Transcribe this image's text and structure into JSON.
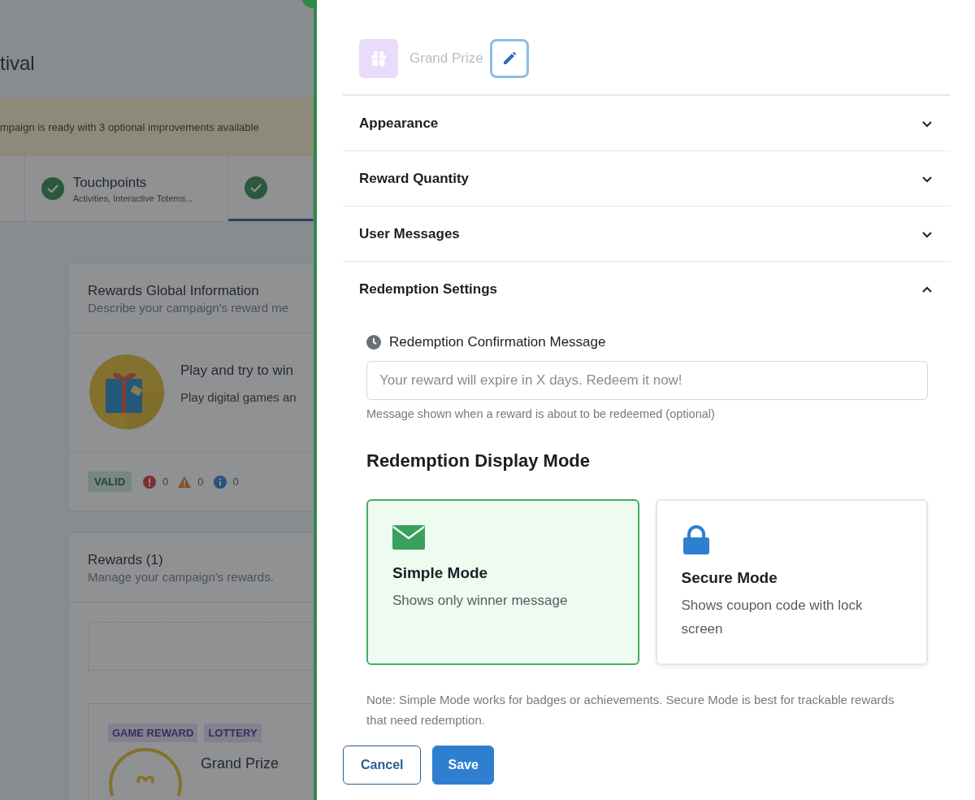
{
  "background_page": {
    "title": "tival",
    "banner": "mpaign is ready with 3 optional improvements available",
    "steps": [
      {
        "title": "Touchpoints",
        "subtitle": "Activities, Interactive Totems...",
        "done": true,
        "selected": false
      },
      {
        "done": true,
        "selected": true
      }
    ],
    "global_info_card": {
      "title": "Rewards Global Information",
      "subtitle": "Describe your campaign's reward me",
      "headline": "Play and try to win",
      "description": "Play digital games an",
      "status": "VALID",
      "counts": [
        {
          "kind": "error",
          "value": "0"
        },
        {
          "kind": "warning",
          "value": "0"
        },
        {
          "kind": "info",
          "value": "0"
        }
      ]
    },
    "rewards_card": {
      "title": "Rewards (1)",
      "subtitle": "Manage your campaign's rewards.",
      "tags": [
        "GAME REWARD",
        "LOTTERY"
      ],
      "reward_name": "Grand Prize"
    }
  },
  "drawer": {
    "reward_name": "Grand Prize",
    "sections": [
      {
        "title": "Appearance",
        "expanded": false
      },
      {
        "title": "Reward Quantity",
        "expanded": false
      },
      {
        "title": "User Messages",
        "expanded": false
      },
      {
        "title": "Redemption Settings",
        "expanded": true
      }
    ],
    "confirmation_message": {
      "label": "Redemption Confirmation Message",
      "placeholder": "Your reward will expire in X days. Redeem it now!",
      "help": "Message shown when a reward is about to be redeemed (optional)"
    },
    "display_mode": {
      "title": "Redemption Display Mode",
      "options": [
        {
          "kind": "simple",
          "title": "Simple Mode",
          "description": "Shows only winner message",
          "selected": true
        },
        {
          "kind": "secure",
          "title": "Secure Mode",
          "description": "Shows coupon code with lock screen",
          "selected": false
        }
      ],
      "note": "Note: Simple Mode works for badges or achievements. Secure Mode is best for trackable rewards that need redemption."
    },
    "buttons": [
      {
        "label": "Cancel",
        "kind": "secondary"
      },
      {
        "label": "Save",
        "kind": "primary"
      }
    ]
  }
}
